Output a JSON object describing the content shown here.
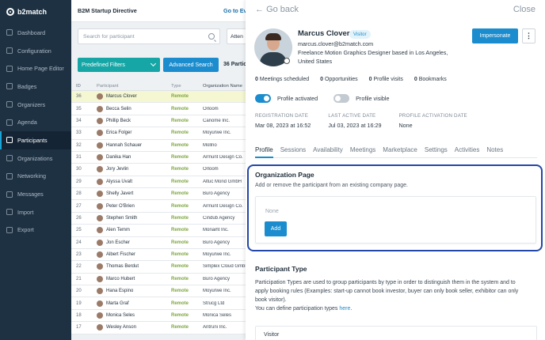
{
  "brand": {
    "name": "b2match"
  },
  "sidebar": {
    "items": [
      {
        "label": "Dashboard",
        "icon": "dashboard-icon"
      },
      {
        "label": "Configuration",
        "icon": "gear-icon"
      },
      {
        "label": "Home Page Editor",
        "icon": "home-icon"
      },
      {
        "label": "Badges",
        "icon": "badge-icon"
      },
      {
        "label": "Organizers",
        "icon": "organizers-icon"
      },
      {
        "label": "Agenda",
        "icon": "calendar-icon"
      },
      {
        "label": "Participants",
        "icon": "participants-icon",
        "active": true
      },
      {
        "label": "Organizations",
        "icon": "building-icon"
      },
      {
        "label": "Networking",
        "icon": "network-icon"
      },
      {
        "label": "Messages",
        "icon": "message-icon"
      },
      {
        "label": "Import",
        "icon": "import-icon"
      },
      {
        "label": "Export",
        "icon": "export-icon"
      }
    ]
  },
  "topbar": {
    "event": "B2M Startup Directive",
    "goto": "Go to Ev"
  },
  "list": {
    "search_placeholder": "Search for participant",
    "attend_label": "Atten",
    "filters_label": "Predefined Filters",
    "advanced_label": "Advanced Search",
    "count_label": "36 Partic",
    "columns": {
      "id": "ID",
      "participant": "Participant",
      "type": "Type",
      "org": "Organization Name"
    },
    "rows": [
      {
        "id": "36",
        "name": "Marcus Clover",
        "type": "Remote",
        "org": ""
      },
      {
        "id": "35",
        "name": "Becca Selin",
        "type": "Remote",
        "org": "Orloom"
      },
      {
        "id": "34",
        "name": "Phillip Beck",
        "type": "Remote",
        "org": "Canome Inc."
      },
      {
        "id": "33",
        "name": "Erica Folger",
        "type": "Remote",
        "org": "Moyurwe Inc."
      },
      {
        "id": "32",
        "name": "Hannah Schauer",
        "type": "Remote",
        "org": "Mollno"
      },
      {
        "id": "31",
        "name": "Danika Han",
        "type": "Remote",
        "org": "Armunt Design Co."
      },
      {
        "id": "30",
        "name": "Jory Jevlin",
        "type": "Remote",
        "org": "Orloom"
      },
      {
        "id": "29",
        "name": "Alyssa Uvalt",
        "type": "Remote",
        "org": "Altuc Mond GmbH"
      },
      {
        "id": "28",
        "name": "Shelly Javert",
        "type": "Remote",
        "org": "Buro Agency"
      },
      {
        "id": "27",
        "name": "Peter O'Brien",
        "type": "Remote",
        "org": "Armunt Design Co."
      },
      {
        "id": "26",
        "name": "Stephen Smith",
        "type": "Remote",
        "org": "Cindub Agency"
      },
      {
        "id": "25",
        "name": "Alen Temm",
        "type": "Remote",
        "org": "Monaiht Inc."
      },
      {
        "id": "24",
        "name": "Jon Escher",
        "type": "Remote",
        "org": "Buro Agency"
      },
      {
        "id": "23",
        "name": "Albert Fischer",
        "type": "Remote",
        "org": "Moyurwe Inc."
      },
      {
        "id": "22",
        "name": "Thomas Berdut",
        "type": "Remote",
        "org": "Simplex Cloud GmbH"
      },
      {
        "id": "21",
        "name": "Marco Hubert",
        "type": "Remote",
        "org": "Buro Agency"
      },
      {
        "id": "20",
        "name": "Hana Espino",
        "type": "Remote",
        "org": "Moyurwe Inc."
      },
      {
        "id": "19",
        "name": "Marta Graf",
        "type": "Remote",
        "org": "Strucg Ltd"
      },
      {
        "id": "18",
        "name": "Monica Seles",
        "type": "Remote",
        "org": "Monica Seles"
      },
      {
        "id": "17",
        "name": "Wesley Anson",
        "type": "Remote",
        "org": "Antruni Inc."
      }
    ]
  },
  "panel": {
    "back_label": "Go back",
    "close_label": "Close",
    "name": "Marcus Clover",
    "badge": "Visitor",
    "email": "marcus.clover@b2match.com",
    "bio": "Freelance Motion Graphics Designer based in Los Angeles, United States",
    "impersonate_label": "Impersonate",
    "more_label": "⋮",
    "stats": [
      {
        "num": "0",
        "label": "Meetings scheduled"
      },
      {
        "num": "0",
        "label": "Opportunities"
      },
      {
        "num": "0",
        "label": "Profile visits"
      },
      {
        "num": "0",
        "label": "Bookmarks"
      }
    ],
    "toggles": {
      "activated": "Profile activated",
      "visible": "Profile visible"
    },
    "meta": [
      {
        "k": "REGISTRATION DATE",
        "v": "Mar 08, 2023 at 16:52"
      },
      {
        "k": "LAST ACTIVE DATE",
        "v": "Jul 03, 2023 at 16:29"
      },
      {
        "k": "PROFILE ACTIVATION DATE",
        "v": "None"
      }
    ],
    "tabs": [
      "Profile",
      "Sessions",
      "Availability",
      "Meetings",
      "Marketplace",
      "Settings",
      "Activities",
      "Notes"
    ],
    "org_page": {
      "heading": "Organization Page",
      "desc": "Add or remove the participant from an existing company page.",
      "none": "None",
      "add": "Add"
    },
    "ptype": {
      "heading": "Participant Type",
      "desc": "Participation Types are used to group participants by type in order to distinguish them in the system and to apply booking rules (Examples: start-up cannot book investor, buyer can only book seller, exhibitor can only book visitor).",
      "link_prefix": "You can define participation types ",
      "link": "here",
      "link_suffix": ".",
      "value": "Visitor"
    }
  }
}
